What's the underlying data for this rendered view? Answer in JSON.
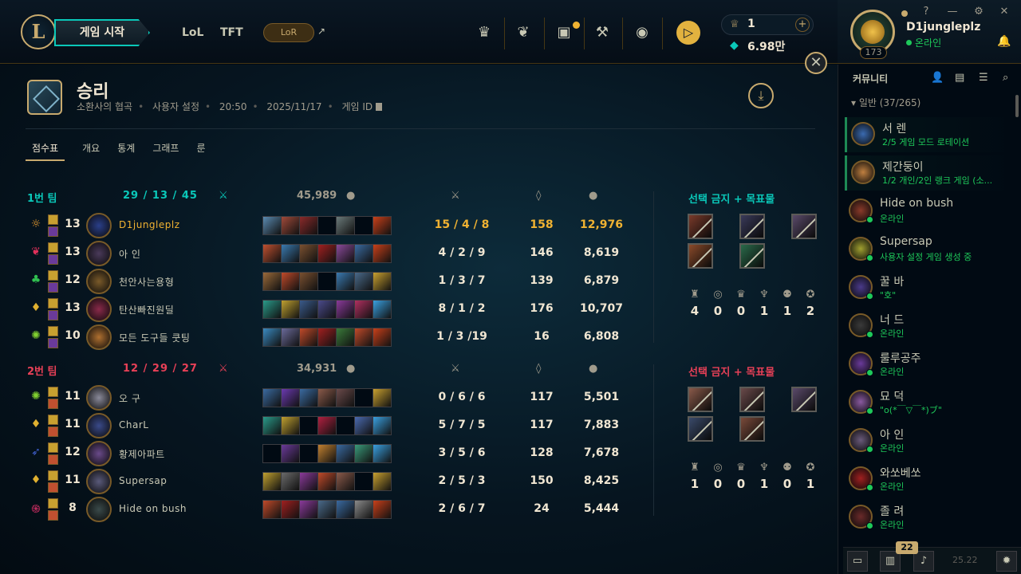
{
  "header": {
    "logo_letter": "L",
    "play_button": "게임 시작",
    "nav": {
      "lol": "LoL",
      "tft": "TFT",
      "lor": "LoR"
    },
    "rp_amount": "1",
    "be_amount": "6.98만"
  },
  "profile": {
    "name": "D1jungleplz",
    "status": "온라인",
    "level": "173"
  },
  "window_controls": {
    "help": "?",
    "minimize": "—",
    "settings": "⚙",
    "close": "✕"
  },
  "match": {
    "result": "승리",
    "map": "소환사의 협곡",
    "mode": "사용자 설정",
    "duration": "20:50",
    "date": "2025/11/17",
    "game_id_label": "게임 ID",
    "tabs": [
      "점수표",
      "개요",
      "통계",
      "그래프",
      "룬"
    ]
  },
  "teams": [
    {
      "name": "1번 팀",
      "color": "#0ac8b9",
      "kda": {
        "k": "29",
        "d": "13",
        "a": "45"
      },
      "gold": "45,989",
      "bans_title": "선택 금지 + 목표물",
      "objectives": [
        "4",
        "0",
        "0",
        "1",
        "1",
        "2"
      ],
      "players": [
        {
          "name": "D1jungleplz",
          "level": "13",
          "kda": "15 / 4 / 8",
          "cs": "158",
          "gold": "12,976",
          "me": true,
          "lane": "☼",
          "lane_color": "#f0a030",
          "champ_color": "#2a3f8a",
          "items": [
            "#5a8ab0",
            "#a04a3a",
            "#8a2a2a",
            "",
            "#6a7a7a",
            "",
            "#c8401a"
          ]
        },
        {
          "name": "아 인",
          "level": "13",
          "kda": "4 / 2 / 9",
          "cs": "146",
          "gold": "8,619",
          "me": false,
          "lane": "❦",
          "lane_color": "#e0305a",
          "champ_color": "#4a3a5a",
          "items": [
            "#c05030",
            "#3a7ab0",
            "#7a5030",
            "#a02020",
            "#8a4a9a",
            "#3a6aa0",
            "#c8401a"
          ]
        },
        {
          "name": "천안사는용형",
          "level": "12",
          "kda": "1 / 3 / 7",
          "cs": "139",
          "gold": "6,879",
          "me": false,
          "lane": "♣",
          "lane_color": "#30c050",
          "champ_color": "#7a5a2a",
          "items": [
            "#9a6a3a",
            "#c04a2a",
            "#7a5030",
            "",
            "#3a7ab0",
            "#4a6a8a",
            "#c8a030"
          ]
        },
        {
          "name": "탄산빠진원딜",
          "level": "13",
          "kda": "8 / 1 / 2",
          "cs": "176",
          "gold": "10,707",
          "me": false,
          "lane": "♦",
          "lane_color": "#e0b030",
          "champ_color": "#8a2a4a",
          "items": [
            "#2a9a8a",
            "#c0a030",
            "#3a5a8a",
            "#4a4a8a",
            "#8a3a9a",
            "#b03060",
            "#3aa0e0"
          ]
        },
        {
          "name": "모든 도구들 쿳팅",
          "level": "10",
          "kda": "1 / 3 /19",
          "cs": "16",
          "gold": "6,808",
          "me": false,
          "lane": "✺",
          "lane_color": "#80d030",
          "champ_color": "#b07030",
          "items": [
            "#3a8ac0",
            "#6a6a9a",
            "#c04a2a",
            "#a02020",
            "#3a7a3a",
            "#c04a2a",
            "#c8401a"
          ]
        }
      ],
      "bans": [
        "#7a3a2a",
        "#3a3a5a",
        "#5a4a6a",
        "#8a4a2a",
        "#2a6a4a"
      ]
    },
    {
      "name": "2번 팀",
      "color": "#e84057",
      "kda": {
        "k": "12",
        "d": "29",
        "a": "27"
      },
      "gold": "34,931",
      "bans_title": "선택 금지 + 목표물",
      "objectives": [
        "1",
        "0",
        "0",
        "1",
        "0",
        "1"
      ],
      "players": [
        {
          "name": "오 구",
          "level": "11",
          "kda": "0 / 6 / 6",
          "cs": "117",
          "gold": "5,501",
          "me": false,
          "lane": "✺",
          "lane_color": "#80d030",
          "champ_color": "#8a8a9a",
          "items": [
            "#3a6aa0",
            "#6a3ab0",
            "#3a6aa0",
            "#8a5a4a",
            "#6a4a4a",
            "",
            "#c8a030"
          ]
        },
        {
          "name": "CharL",
          "level": "11",
          "kda": "5 / 7 / 5",
          "cs": "117",
          "gold": "7,883",
          "me": false,
          "lane": "♦",
          "lane_color": "#e0b030",
          "champ_color": "#3a4a8a",
          "items": [
            "#2a9a8a",
            "#c0a030",
            "",
            "#b02040",
            "",
            "#4a6ab0",
            "#3aa0e0"
          ]
        },
        {
          "name": "황제아파트",
          "level": "12",
          "kda": "3 / 5 / 6",
          "cs": "128",
          "gold": "7,678",
          "me": false,
          "lane": "➶",
          "lane_color": "#4060d0",
          "champ_color": "#6a4a8a",
          "items": [
            "",
            "#6a3a9a",
            "",
            "#c08030",
            "#3a6aa0",
            "#3a9a7a",
            "#3aa0e0"
          ]
        },
        {
          "name": "Supersap",
          "level": "11",
          "kda": "2 / 5 / 3",
          "cs": "150",
          "gold": "8,425",
          "me": false,
          "lane": "♦",
          "lane_color": "#e0b030",
          "champ_color": "#5a5a7a",
          "items": [
            "#c0a030",
            "#6a6a6a",
            "#8a3a9a",
            "#c04a2a",
            "#8a5a4a",
            "",
            "#c8a030"
          ]
        },
        {
          "name": "Hide on bush",
          "level": "8",
          "kda": "2 / 6 / 7",
          "cs": "24",
          "gold": "5,444",
          "me": false,
          "lane": "֍",
          "lane_color": "#e0306a",
          "champ_color": "#3a4a4a",
          "items": [
            "#c04a2a",
            "#a02020",
            "#8a3a9a",
            "#4a6a8a",
            "#3a6aa0",
            "#8a8a8a",
            "#c8401a"
          ]
        }
      ],
      "bans": [
        "#8a5a4a",
        "#6a4a4a",
        "#5a4a6a",
        "#3a4a6a",
        "#7a4a3a"
      ]
    }
  ],
  "social": {
    "title": "커뮤니티",
    "group": "일반 (37/265)",
    "friends": [
      {
        "name": "서 렌",
        "status": "2/5 게임 모드 로테이션",
        "ingame": true,
        "color": "#3a6ab0"
      },
      {
        "name": "제간둥이",
        "status": "1/2 개인/2인 랭크 게임 (소...",
        "ingame": true,
        "color": "#c08040"
      },
      {
        "name": "Hide on bush",
        "status": "온라인",
        "ingame": false,
        "color": "#8a3a2a"
      },
      {
        "name": "Supersap",
        "status": "사용자 설정 게임 생성 중",
        "ingame": false,
        "color": "#a0a030"
      },
      {
        "name": "꿀 바",
        "status": "\"호\"",
        "ingame": false,
        "color": "#4a3a8a"
      },
      {
        "name": "너 드",
        "status": "온라인",
        "ingame": false,
        "color": "#3a3a3a"
      },
      {
        "name": "룰루공주",
        "status": "온라인",
        "ingame": false,
        "color": "#6a3a9a"
      },
      {
        "name": "묘 덕",
        "status": "\"o(*￣▽￣*)ブ\"",
        "ingame": false,
        "color": "#8a5aa0"
      },
      {
        "name": "아 인",
        "status": "온라인",
        "ingame": false,
        "color": "#6a5a7a"
      },
      {
        "name": "와쏘베쏘",
        "status": "온라인",
        "ingame": false,
        "color": "#a02020"
      },
      {
        "name": "졸 려",
        "status": "온라인",
        "ingame": false,
        "color": "#6a2a2a"
      }
    ]
  },
  "bottom": {
    "count": "22",
    "version": "25.22"
  }
}
